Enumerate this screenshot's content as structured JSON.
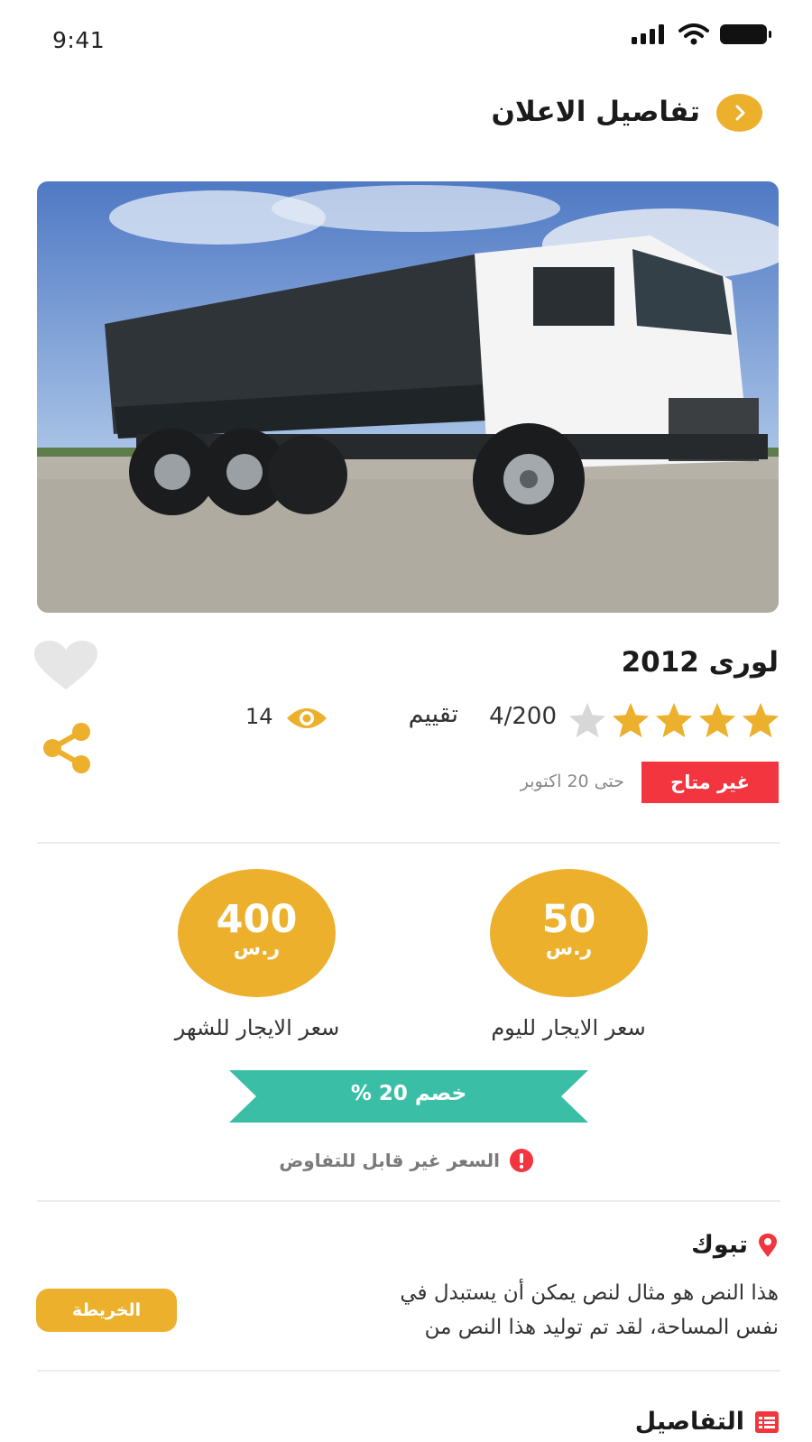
{
  "status_bar": {
    "time": "9:41"
  },
  "header": {
    "title": "تفاصيل الاعلان"
  },
  "ad": {
    "title": "لورى 2012",
    "rating": {
      "stars_filled": 4,
      "stars_total": 5,
      "count": "4/200",
      "label": "تقييم"
    },
    "views": "14",
    "availability": {
      "badge": "غير متاح",
      "until": "حتى 20 اكتوبر"
    }
  },
  "prices": {
    "daily": {
      "value": "50",
      "currency": "ر.س",
      "label": "سعر الايجار لليوم"
    },
    "monthly": {
      "value": "400",
      "currency": "ر.س",
      "label": "سعر الايجار للشهر"
    }
  },
  "discount": "خصم 20 %",
  "negotiation_note": "السعر غير قابل للتفاوض",
  "location": {
    "city": "تبوك",
    "description_lines": [
      "هذا النص هو مثال لنص يمكن أن يستبدل في",
      "نفس المساحة، لقد تم توليد هذا النص من"
    ],
    "map_button": "الخريطة"
  },
  "details_section": {
    "title": "التفاصيل"
  },
  "colors": {
    "accent": "#ecb02c",
    "unavailable": "#f2353e",
    "discount": "#3abfa6",
    "star_empty": "#d7d7d7",
    "heart": "#e6e6e6"
  },
  "icons": [
    "back-chevron-icon",
    "heart-icon",
    "share-icon",
    "star-icon",
    "eye-icon",
    "alert-icon",
    "location-pin-icon",
    "details-list-icon",
    "signal-icon",
    "wifi-icon",
    "battery-icon"
  ]
}
